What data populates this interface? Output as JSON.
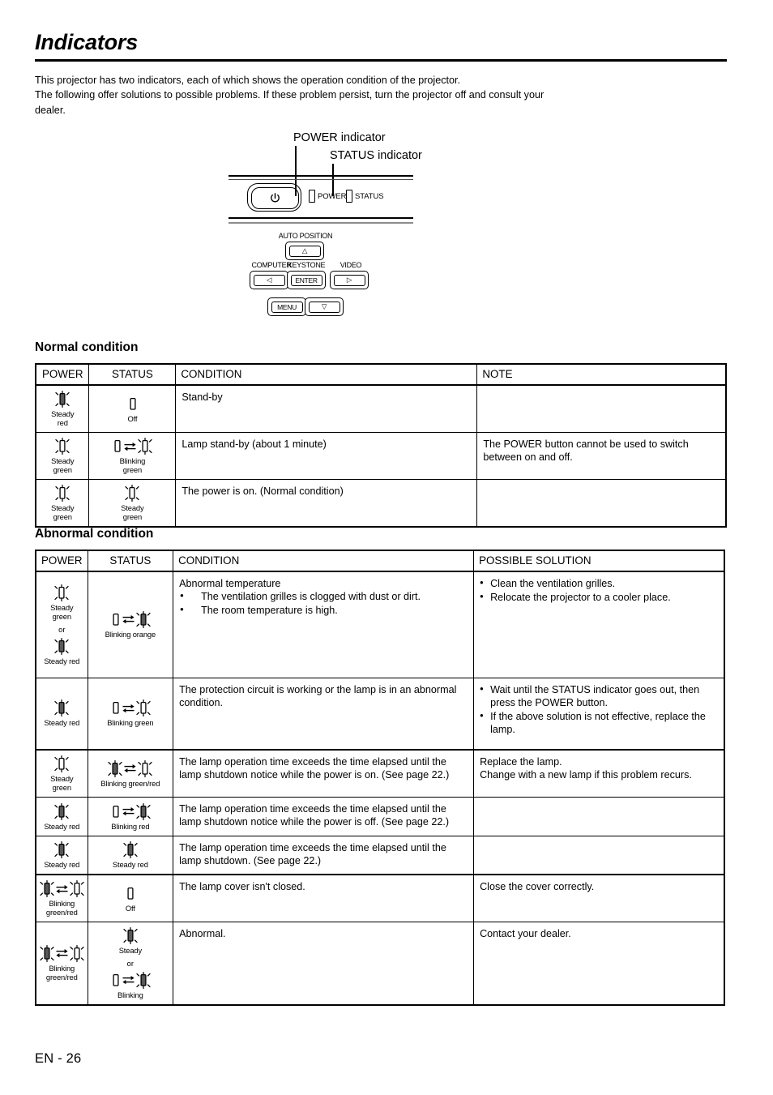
{
  "document": {
    "title": "Indicators",
    "intro_line1": "This projector has two indicators, each of which shows the operation condition of the projector.",
    "intro_line2": "The following offer solutions to possible problems. If these problem persist, turn the projector off and consult your",
    "intro_line3": "dealer.",
    "footer": "EN - 26"
  },
  "diagram": {
    "callout_power": "POWER indicator",
    "callout_status": "STATUS indicator",
    "led_power_label": "POWER",
    "led_status_label": "STATUS",
    "keys": {
      "auto_position": "AUTO POSITION",
      "computer": "COMPUTER",
      "keystone": "KEYSTONE",
      "video": "VIDEO",
      "enter": "ENTER",
      "menu": "MENU",
      "up": "△",
      "down": "▽",
      "left": "◁",
      "right": "▷",
      "power_symbol": "⏻"
    }
  },
  "normal": {
    "heading": "Normal condition",
    "headers": [
      "POWER",
      "STATUS",
      "CONDITION",
      "NOTE"
    ],
    "rows": [
      {
        "power": {
          "mode": "steady",
          "color": "red",
          "caption": "Steady\nred"
        },
        "status": {
          "mode": "off",
          "color": "off",
          "caption": "Off"
        },
        "condition": "Stand-by",
        "note": ""
      },
      {
        "power": {
          "mode": "steady",
          "color": "green",
          "caption": "Steady\ngreen"
        },
        "status": {
          "mode": "blink-off",
          "color": "green",
          "caption": "Blinking\ngreen"
        },
        "condition": "Lamp stand-by (about 1 minute)",
        "note": "The POWER button cannot be used to switch between on and off."
      },
      {
        "power": {
          "mode": "steady",
          "color": "green",
          "caption": "Steady\ngreen"
        },
        "status": {
          "mode": "steady",
          "color": "green",
          "caption": "Steady\ngreen"
        },
        "condition": "The power is on. (Normal condition)",
        "note": ""
      }
    ]
  },
  "abnormal": {
    "heading": "Abnormal condition",
    "headers": [
      "POWER",
      "STATUS",
      "CONDITION",
      "POSSIBLE SOLUTION"
    ],
    "rows": [
      {
        "power": {
          "mode": "two-stacked",
          "first": {
            "mode": "steady",
            "color": "green",
            "caption": "Steady\ngreen"
          },
          "or_label": "or",
          "second": {
            "mode": "steady",
            "color": "red",
            "caption": "Steady red"
          }
        },
        "status": {
          "mode": "blink-off",
          "color": "orange",
          "caption": "Blinking orange"
        },
        "condition_title": "Abnormal temperature",
        "condition_bullets": [
          "The ventilation grilles is clogged with dust or dirt.",
          "The room temperature is high."
        ],
        "solution_bullets": [
          "Clean the ventilation grilles.",
          "Relocate the projector to a cooler place."
        ]
      },
      {
        "power": {
          "mode": "steady",
          "color": "red",
          "caption": "Steady red"
        },
        "status": {
          "mode": "blink-off",
          "color": "green",
          "caption": "Blinking green"
        },
        "condition_text": "The protection circuit is working or the lamp is in an abnormal condition.",
        "solution_bullets": [
          "Wait until the STATUS indicator goes out, then press the POWER button.",
          "If the above solution is not effective, replace the lamp."
        ]
      },
      {
        "power": {
          "mode": "steady",
          "color": "green",
          "caption": "Steady\ngreen"
        },
        "status": {
          "mode": "blink-two",
          "color": "green-red",
          "caption": "Blinking green/red"
        },
        "condition_text": "The lamp operation time exceeds the time elapsed until the lamp shutdown notice while the power is on. (See page 22.)",
        "solution_text": "Replace the lamp.\nChange with a new lamp if this problem recurs."
      },
      {
        "power": {
          "mode": "steady",
          "color": "red",
          "caption": "Steady red"
        },
        "status": {
          "mode": "blink-off",
          "color": "red",
          "caption": "Blinking red"
        },
        "condition_text": "The lamp operation time exceeds the time elapsed until the lamp shutdown notice while the power is off. (See page 22.)",
        "solution_text": ""
      },
      {
        "power": {
          "mode": "steady",
          "color": "red",
          "caption": "Steady red"
        },
        "status": {
          "mode": "steady",
          "color": "red",
          "caption": "Steady red"
        },
        "condition_text": "The lamp operation time exceeds the time elapsed until the lamp shutdown. (See page 22.)",
        "solution_text": ""
      },
      {
        "power": {
          "mode": "blink-two",
          "color": "green-red",
          "caption": "Blinking\ngreen/red"
        },
        "status": {
          "mode": "off",
          "color": "off",
          "caption": "Off"
        },
        "condition_text": "The lamp cover isn't closed.",
        "solution_text": "Close the cover correctly."
      },
      {
        "power": {
          "mode": "blink-two",
          "color": "green-red",
          "caption": "Blinking\ngreen/red"
        },
        "status": {
          "mode": "two-stacked",
          "first": {
            "mode": "steady",
            "color": "red",
            "caption": "Steady"
          },
          "or_label": "or",
          "second": {
            "mode": "blink-off",
            "color": "red",
            "caption": "Blinking"
          }
        },
        "condition_text": "Abnormal.",
        "solution_text": "Contact your dealer."
      }
    ]
  },
  "colors": {
    "filled_lamp": "#595959",
    "outline_lamp": "#ffffff",
    "stroke": "#000000"
  }
}
